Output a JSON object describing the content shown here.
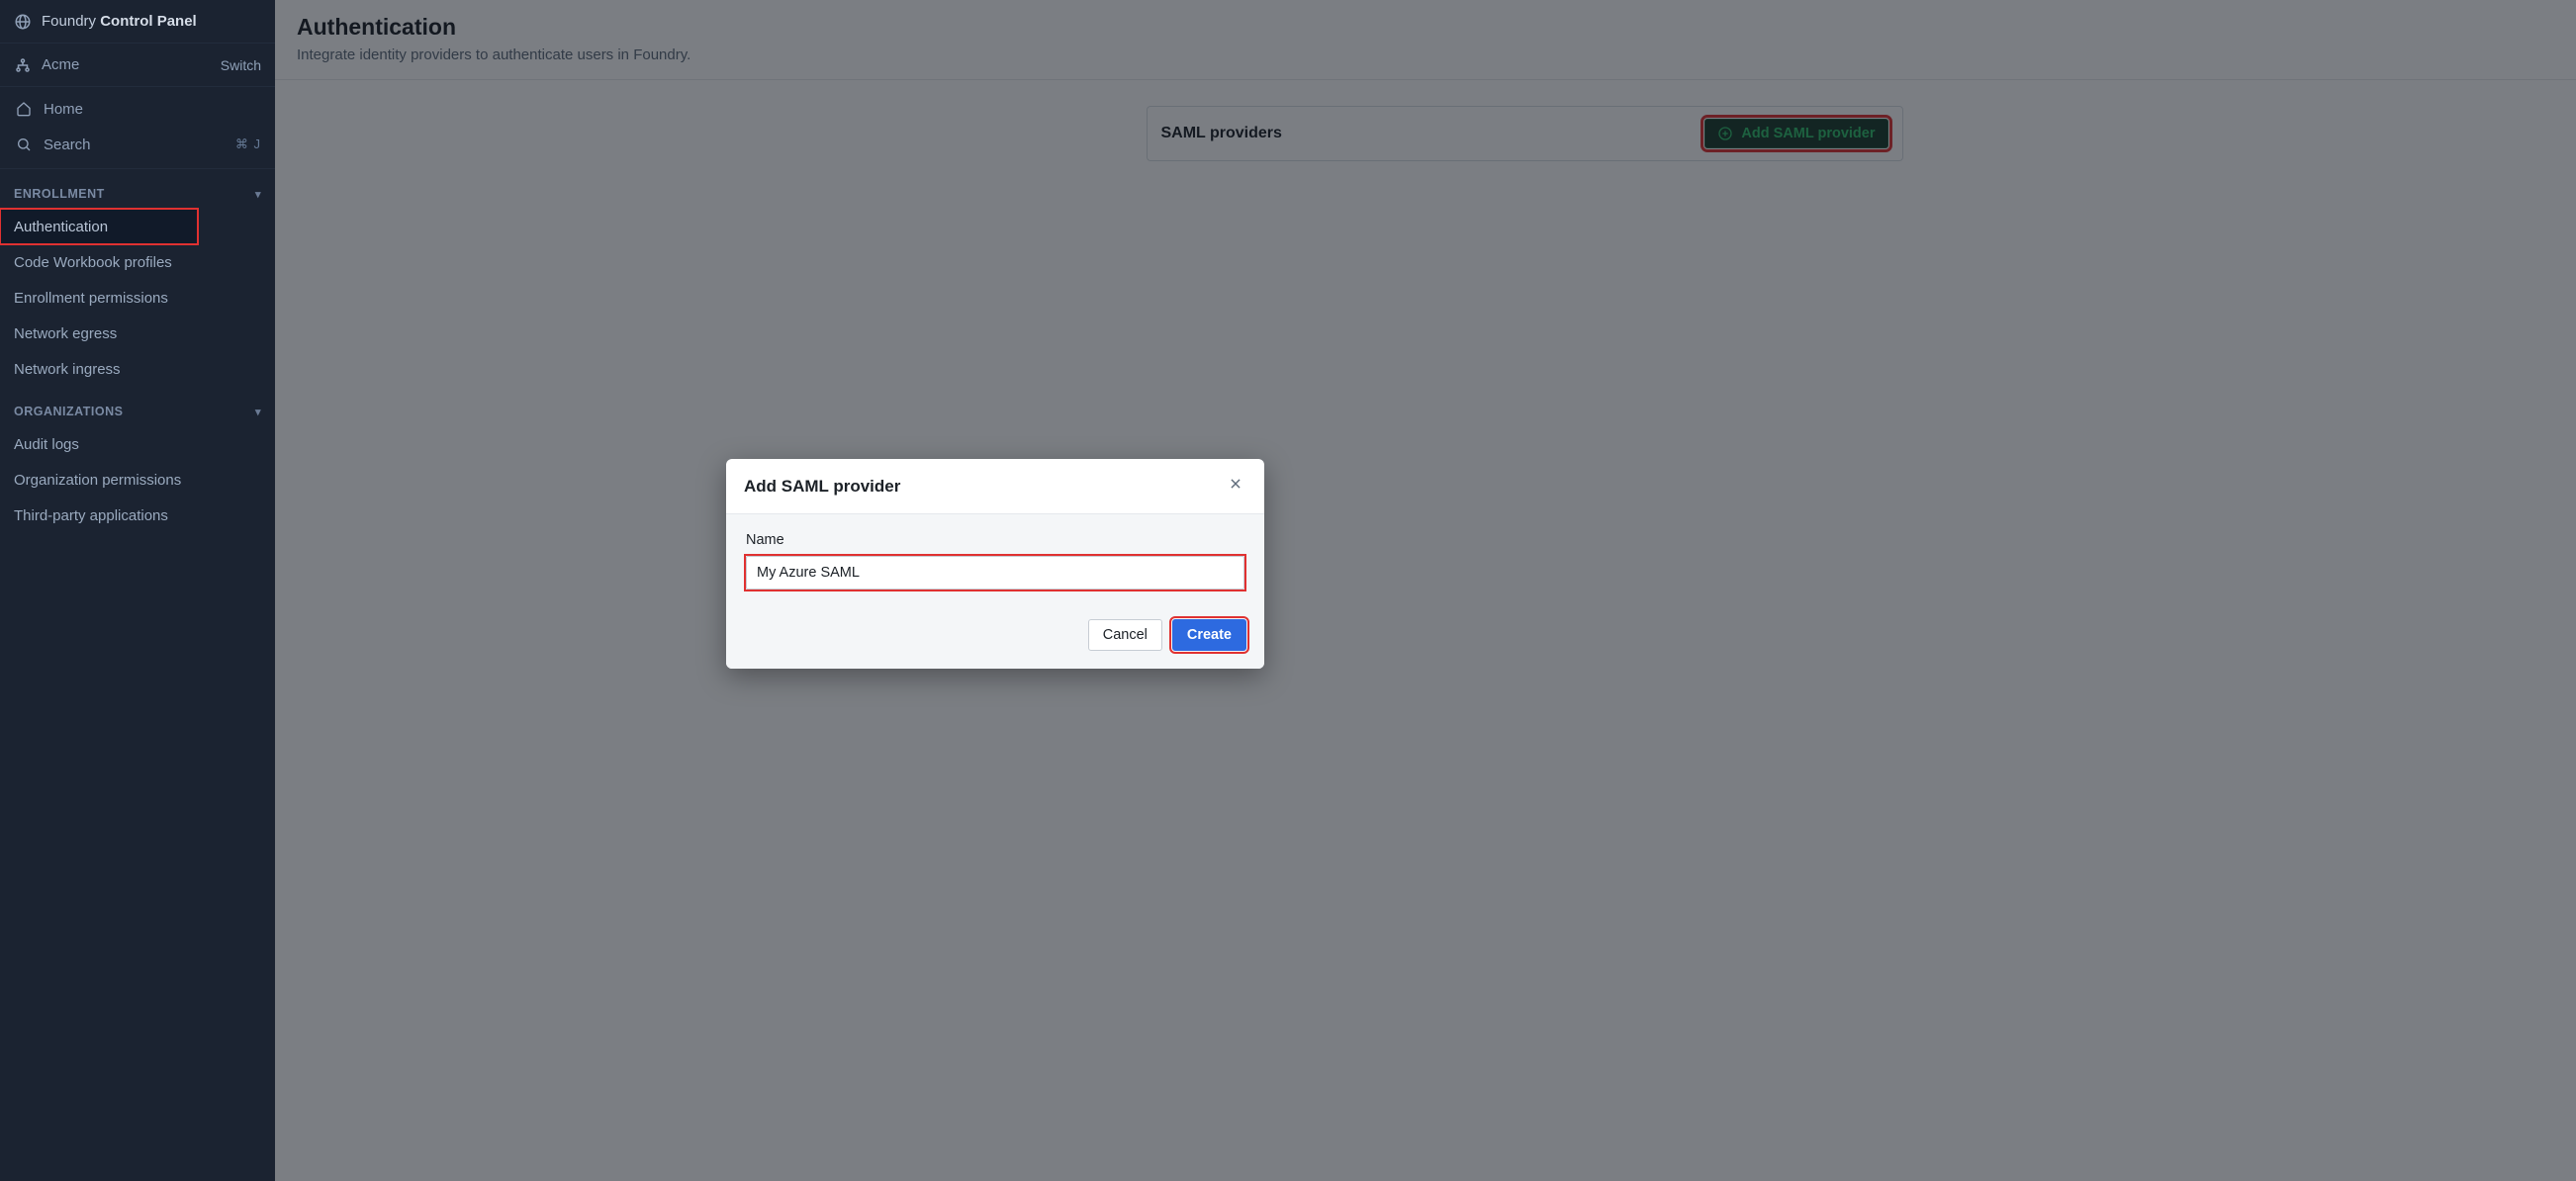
{
  "sidebar": {
    "brand_prefix": "Foundry ",
    "brand_bold": "Control Panel",
    "org_name": "Acme",
    "switch_label": "Switch",
    "home_label": "Home",
    "search_label": "Search",
    "search_kbd": "⌘ J",
    "sections": {
      "enrollment": {
        "title": "ENROLLMENT",
        "items": [
          {
            "label": "Authentication",
            "active": true,
            "highlight": true
          },
          {
            "label": "Code Workbook profiles"
          },
          {
            "label": "Enrollment permissions"
          },
          {
            "label": "Network egress"
          },
          {
            "label": "Network ingress"
          }
        ]
      },
      "organizations": {
        "title": "ORGANIZATIONS",
        "items": [
          {
            "label": "Audit logs"
          },
          {
            "label": "Organization permissions"
          },
          {
            "label": "Third-party applications"
          }
        ]
      }
    }
  },
  "page": {
    "title": "Authentication",
    "subtitle": "Integrate identity providers to authenticate users in Foundry."
  },
  "card": {
    "title": "SAML providers",
    "add_button": "Add SAML provider"
  },
  "dialog": {
    "title": "Add SAML provider",
    "name_label": "Name",
    "name_value": "My Azure SAML",
    "cancel": "Cancel",
    "create": "Create"
  }
}
